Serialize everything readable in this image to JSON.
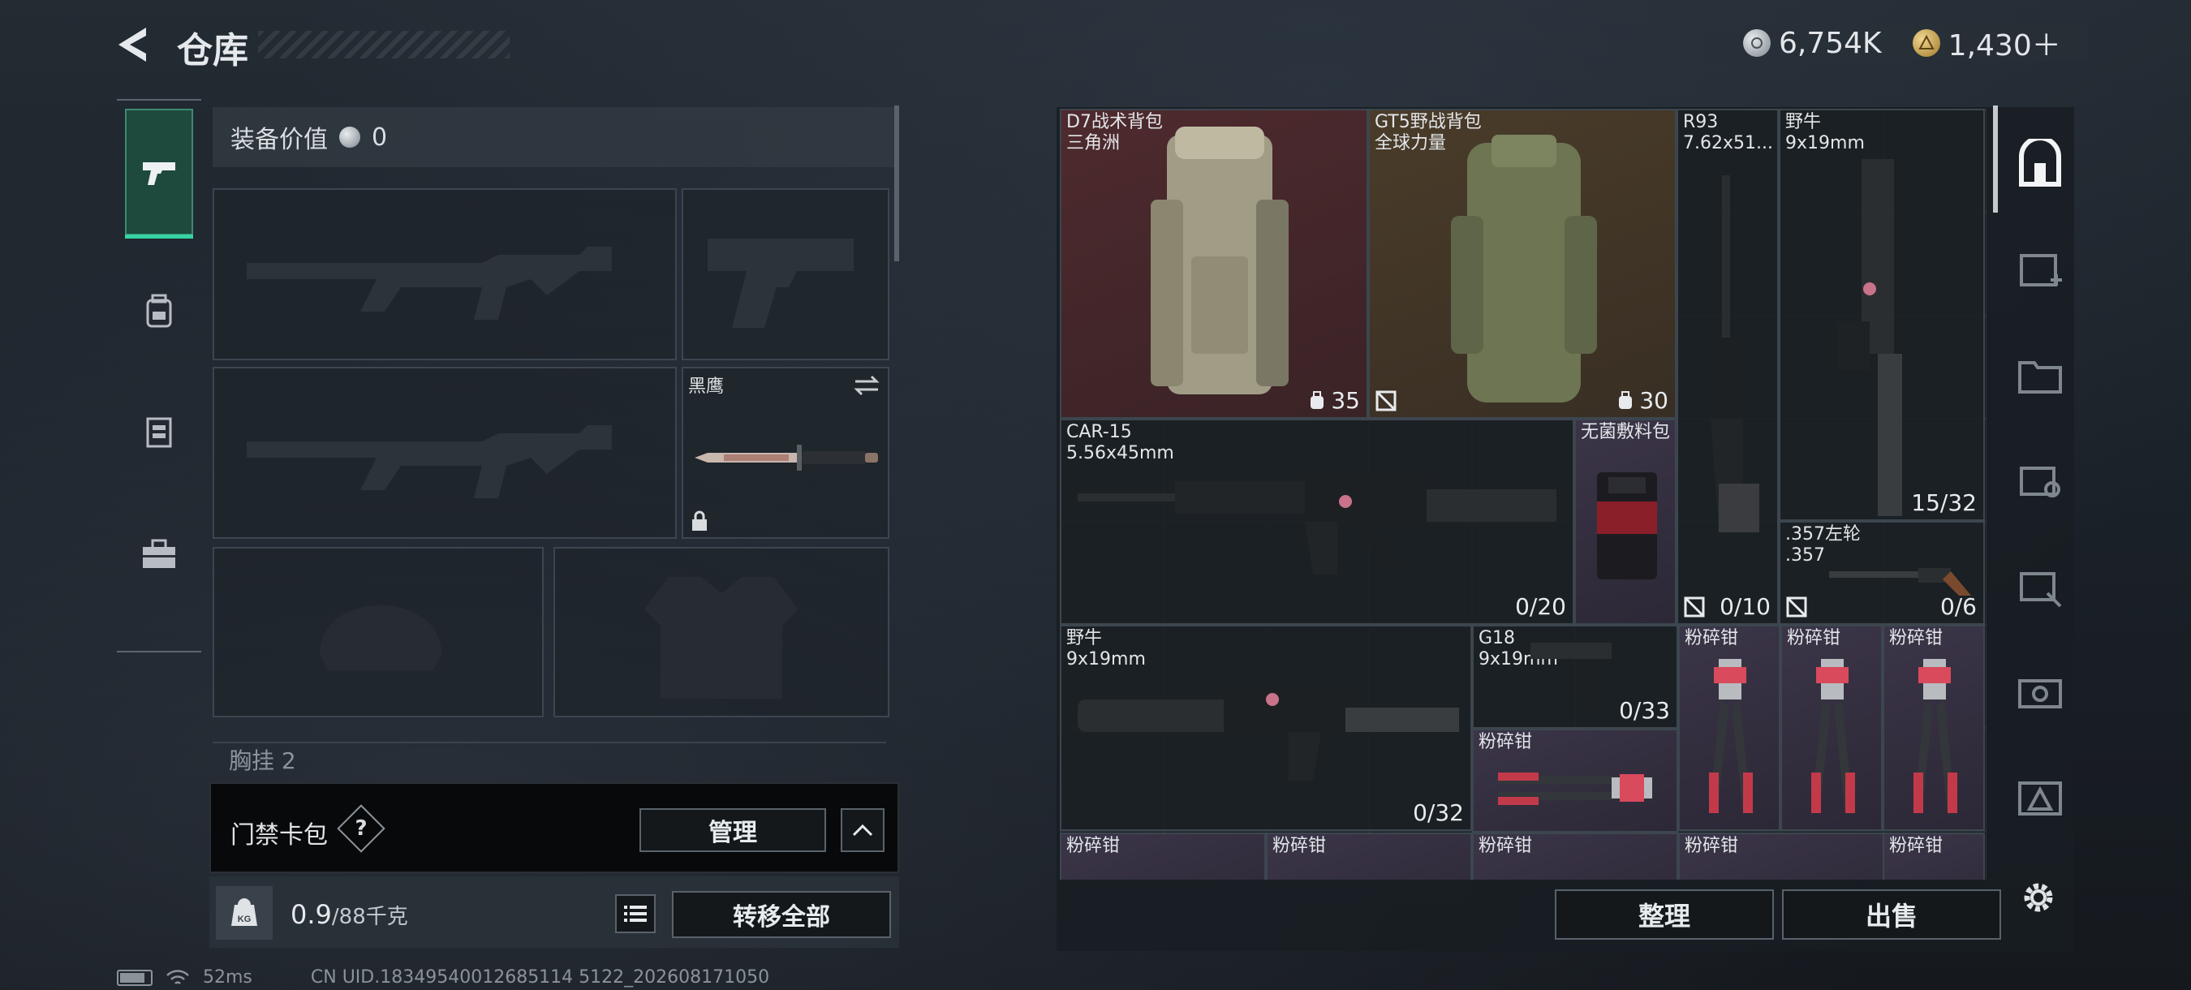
{
  "header": {
    "title": "仓库",
    "currency": [
      {
        "icon": "silver-coin-icon",
        "value": "6,754K"
      },
      {
        "icon": "gold-coin-icon",
        "value": "1,430＋"
      }
    ]
  },
  "left_nav": {
    "items": [
      {
        "name": "weapons-tab",
        "icon": "pistol-icon",
        "active": true
      },
      {
        "name": "backpack-tab",
        "icon": "backpack-icon"
      },
      {
        "name": "rig-tab",
        "icon": "vest-icon"
      },
      {
        "name": "items-tab",
        "icon": "briefcase-icon"
      }
    ]
  },
  "equipment": {
    "value_label": "装备价值",
    "value": "0",
    "melee_slot": {
      "label": "黑鹰"
    },
    "chest_label": "胸挂",
    "chest_count": "2"
  },
  "keycard": {
    "label": "门禁卡包",
    "help": "?",
    "manage_label": "管理"
  },
  "weight": {
    "badge": "KG",
    "current": "0.9",
    "max": "/88千克"
  },
  "actions": {
    "transfer_all": "转移全部",
    "sort": "整理",
    "sell": "出售"
  },
  "status": {
    "ping": "52ms",
    "uid": "CN UID.18349540012685114 5122_202608171050"
  },
  "stash": {
    "items": [
      {
        "name": "D7战术背包",
        "sub": "三角洲",
        "count": "35",
        "rarity": "red"
      },
      {
        "name": "GT5野战背包",
        "sub": "全球力量",
        "count": "30",
        "rarity": "brown"
      },
      {
        "name": "R93",
        "sub": "7.62x51...",
        "count": "0/10"
      },
      {
        "name": "野牛",
        "sub": "9x19mm",
        "count": "15/32"
      },
      {
        "name": "CAR-15",
        "sub": "5.56x45mm",
        "count": "0/20"
      },
      {
        "name": "无菌敷料包",
        "sub": "",
        "count": "",
        "rarity": "purple"
      },
      {
        "name": ".357左轮",
        "sub": ".357",
        "count": "0/6"
      },
      {
        "name": "野牛",
        "sub": "9x19mm",
        "count": "0/32"
      },
      {
        "name": "G18",
        "sub": "9x19mm",
        "count": "0/33"
      },
      {
        "name": "粉碎钳",
        "sub": "",
        "count": "",
        "rarity": "purple"
      },
      {
        "name": "粉碎钳",
        "sub": "",
        "count": "",
        "rarity": "purple"
      },
      {
        "name": "粉碎钳",
        "sub": "",
        "count": "",
        "rarity": "purple"
      },
      {
        "name": "粉碎钳",
        "sub": "",
        "count": "",
        "rarity": "purple"
      },
      {
        "name": "粉碎钳",
        "sub": "",
        "count": "",
        "rarity": "purple"
      },
      {
        "name": "粉碎钳",
        "sub": "",
        "count": "",
        "rarity": "purple"
      },
      {
        "name": "粉碎钳",
        "sub": "",
        "count": "",
        "rarity": "purple"
      },
      {
        "name": "粉碎钳",
        "sub": "",
        "count": "",
        "rarity": "purple"
      },
      {
        "name": "粉碎钳",
        "sub": "",
        "count": "",
        "rarity": "purple"
      }
    ]
  },
  "side_icons": [
    "stash-main-icon",
    "stash-tab-iv-add-icon",
    "stash-tab-iv-folder-icon",
    "stash-tab-ii-key-icon",
    "stash-tab-v-tool-icon",
    "stash-tab-iv-camera-icon",
    "stash-tab-iv-warning-icon"
  ],
  "colors": {
    "accent": "#35d4a2",
    "red_rarity": "#4e2a2e",
    "purple_rarity": "#3b3548",
    "brown_rarity": "#4a3c2a"
  }
}
